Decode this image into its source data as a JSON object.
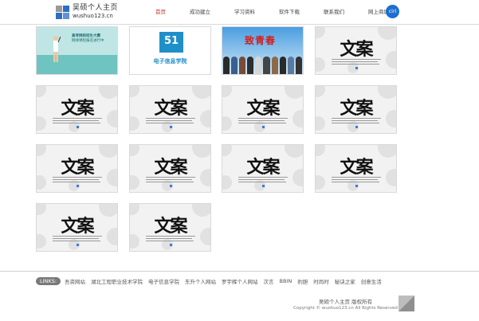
{
  "header": {
    "logo_title": "吴硕个人主页",
    "logo_sub": "wushuo123.cn",
    "nav": [
      "首页",
      "成功建立",
      "学习资料",
      "软件下载",
      "联系我们",
      "网上商城"
    ],
    "badge": "ciri",
    "colors": {
      "logo_blue": "#2c6fbf",
      "logo_gray": "#9a9a9a",
      "badge": "#1d6fd0"
    }
  },
  "thumbnails": [
    {
      "kind": "sport",
      "caption": "高考网校招生大赛",
      "caption2": "网球课程报名进行中"
    },
    {
      "kind": "school",
      "logo_text": "51",
      "caption": "电子信息学院"
    },
    {
      "kind": "youth",
      "title": "致青春"
    },
    {
      "kind": "placeholder",
      "glyph": "文案"
    },
    {
      "kind": "placeholder",
      "glyph": "文案"
    },
    {
      "kind": "placeholder",
      "glyph": "文案"
    },
    {
      "kind": "placeholder",
      "glyph": "文案"
    },
    {
      "kind": "placeholder",
      "glyph": "文案"
    },
    {
      "kind": "placeholder",
      "glyph": "文案"
    },
    {
      "kind": "placeholder",
      "glyph": "文案"
    },
    {
      "kind": "placeholder",
      "glyph": "文案"
    },
    {
      "kind": "placeholder",
      "glyph": "文案"
    },
    {
      "kind": "placeholder",
      "glyph": "文案"
    },
    {
      "kind": "placeholder",
      "glyph": "文案"
    }
  ],
  "footer": {
    "links_label": "LINKS:",
    "links": [
      "吾资网站",
      "湖北工程职业技术学院",
      "电子信息学院",
      "东升个人网站",
      "罗宇辉个人网站",
      "次言",
      "BBIN",
      "豹胆",
      "时尚时",
      "秘诀之家",
      "创意生活"
    ],
    "site_name": "吴硕个人主页  版权所有",
    "copyright": "Copyright © wushuo123.cn All Rights Reserved"
  }
}
